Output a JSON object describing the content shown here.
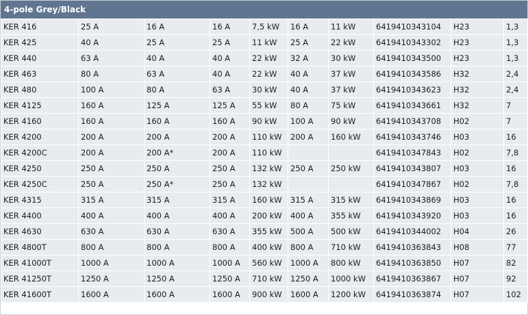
{
  "table": {
    "title": "4-pole Grey/Black",
    "rows": [
      [
        "KER 416",
        "25 A",
        "16 A",
        "16 A",
        "7,5 kW",
        "16 A",
        "11 kW",
        "6419410343104",
        "H23",
        "1,3"
      ],
      [
        "KER 425",
        "40 A",
        "25 A",
        "25 A",
        "11 kW",
        "25 A",
        "22 kW",
        "6419410343302",
        "H23",
        "1,3"
      ],
      [
        "KER 440",
        "63 A",
        "40 A",
        "40 A",
        "22 kW",
        "32 A",
        "30 kW",
        "6419410343500",
        "H23",
        "1,3"
      ],
      [
        "KER 463",
        "80 A",
        "63 A",
        "40 A",
        "22 kW",
        "40 A",
        "37 kW",
        "6419410343586",
        "H32",
        "2,4"
      ],
      [
        "KER 480",
        "100 A",
        "80 A",
        "63 A",
        "30 kW",
        "40 A",
        "37 kW",
        "6419410343623",
        "H32",
        "2,4"
      ],
      [
        "KER 4125",
        "160 A",
        "125 A",
        "125 A",
        "55 kW",
        "80 A",
        "75 kW",
        "6419410343661",
        "H32",
        "7"
      ],
      [
        "KER 4160",
        "160 A",
        "160 A",
        "160 A",
        "90 kW",
        "100 A",
        "90 kW",
        "6419410343708",
        "H02",
        "7"
      ],
      [
        "KER 4200",
        "200 A",
        "200 A",
        "200 A",
        "110 kW",
        "200 A",
        "160 kW",
        "6419410343746",
        "H03",
        "16"
      ],
      [
        "KER 4200C",
        "200 A",
        "200 A*",
        "200 A",
        "110 kW",
        "",
        "",
        "6419410347843",
        "H02",
        "7,8"
      ],
      [
        "KER 4250",
        "250 A",
        "250 A",
        "250 A",
        "132 kW",
        "250 A",
        "250 kW",
        "6419410343807",
        "H03",
        "16"
      ],
      [
        "KER 4250C",
        "250 A",
        "250 A*",
        "250 A",
        "132 kW",
        "",
        "",
        "6419410347867",
        "H02",
        "7,8"
      ],
      [
        "KER 4315",
        "315 A",
        "315 A",
        "315 A",
        "160 kW",
        "315 A",
        "315 kW",
        "6419410343869",
        "H03",
        "16"
      ],
      [
        "KER 4400",
        "400 A",
        "400 A",
        "400 A",
        "200 kW",
        "400 A",
        "355 kW",
        "6419410343920",
        "H03",
        "16"
      ],
      [
        "KER 4630",
        "630 A",
        "630 A",
        "630 A",
        "355 kW",
        "500 A",
        "500 kW",
        "6419410344002",
        "H04",
        "26"
      ],
      [
        "KER 4800T",
        "800 A",
        "800 A",
        "800 A",
        "400 kW",
        "800 A",
        "710 kW",
        "6419410363843",
        "H08",
        "77"
      ],
      [
        "KER 41000T",
        "1000 A",
        "1000 A",
        "1000 A",
        "560 kW",
        "1000 A",
        "800 kW",
        "6419410363850",
        "H07",
        "82"
      ],
      [
        "KER 41250T",
        "1250 A",
        "1250 A",
        "1250 A",
        "710 kW",
        "1250 A",
        "1000 kW",
        "6419410363867",
        "H07",
        "92"
      ],
      [
        "KER 41600T",
        "1600 A",
        "1600 A",
        "1600 A",
        "900 kW",
        "1600 A",
        "1200 kW",
        "6419410363874",
        "H07",
        "102"
      ]
    ]
  }
}
